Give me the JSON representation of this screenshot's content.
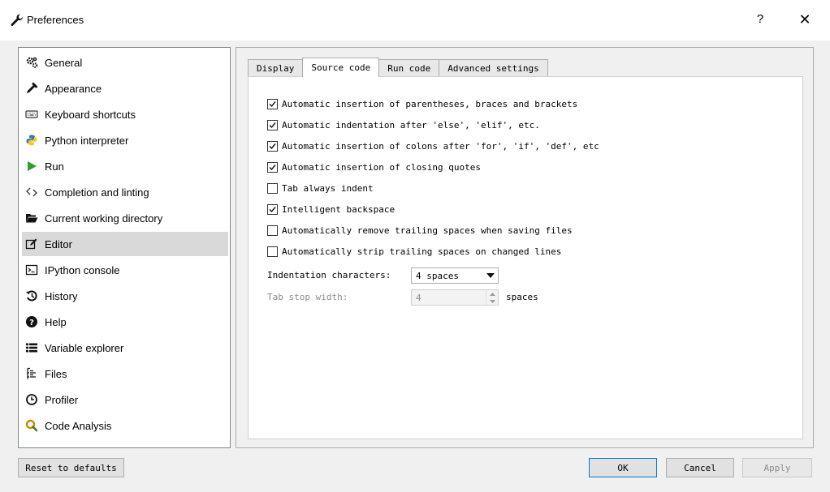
{
  "window": {
    "title": "Preferences",
    "help_label": "?",
    "close_label": "✕",
    "title_icon": "wrench-icon"
  },
  "sidebar": {
    "items": [
      {
        "label": "General",
        "icon": "gears-icon"
      },
      {
        "label": "Appearance",
        "icon": "eyedropper-icon"
      },
      {
        "label": "Keyboard shortcuts",
        "icon": "keyboard-icon"
      },
      {
        "label": "Python interpreter",
        "icon": "python-icon"
      },
      {
        "label": "Run",
        "icon": "play-icon"
      },
      {
        "label": "Completion and linting",
        "icon": "code-brackets-icon"
      },
      {
        "label": "Current working directory",
        "icon": "folder-open-icon"
      },
      {
        "label": "Editor",
        "icon": "edit-icon",
        "selected": true
      },
      {
        "label": "IPython console",
        "icon": "console-icon"
      },
      {
        "label": "History",
        "icon": "history-icon"
      },
      {
        "label": "Help",
        "icon": "question-circle-icon"
      },
      {
        "label": "Variable explorer",
        "icon": "table-list-icon"
      },
      {
        "label": "Files",
        "icon": "files-icon"
      },
      {
        "label": "Profiler",
        "icon": "clock-icon"
      },
      {
        "label": "Code Analysis",
        "icon": "magnifier-icon"
      }
    ]
  },
  "tabs": [
    {
      "label": "Display",
      "active": false
    },
    {
      "label": "Source code",
      "active": true
    },
    {
      "label": "Run code",
      "active": false
    },
    {
      "label": "Advanced settings",
      "active": false
    }
  ],
  "source_code": {
    "options": [
      {
        "label": "Automatic insertion of parentheses, braces and brackets",
        "checked": true
      },
      {
        "label": "Automatic indentation after 'else', 'elif', etc.",
        "checked": true
      },
      {
        "label": "Automatic insertion of colons after 'for', 'if', 'def', etc",
        "checked": true
      },
      {
        "label": "Automatic insertion of closing quotes",
        "checked": true
      },
      {
        "label": "Tab always indent",
        "checked": false
      },
      {
        "label": "Intelligent backspace",
        "checked": true
      },
      {
        "label": "Automatically remove trailing spaces when saving files",
        "checked": false
      },
      {
        "label": "Automatically strip trailing spaces on changed lines",
        "checked": false
      }
    ],
    "indentation_label": "Indentation characters:",
    "indentation_value": "4 spaces",
    "tab_stop_label": "Tab stop width:",
    "tab_stop_value": "4",
    "tab_stop_suffix": "spaces"
  },
  "buttons": {
    "reset": "Reset to defaults",
    "ok": "OK",
    "cancel": "Cancel",
    "apply": "Apply"
  },
  "colors": {
    "selected_item": "#d9d9d9",
    "default_button_border": "#0078d7",
    "run_icon": "#2ca02c"
  }
}
